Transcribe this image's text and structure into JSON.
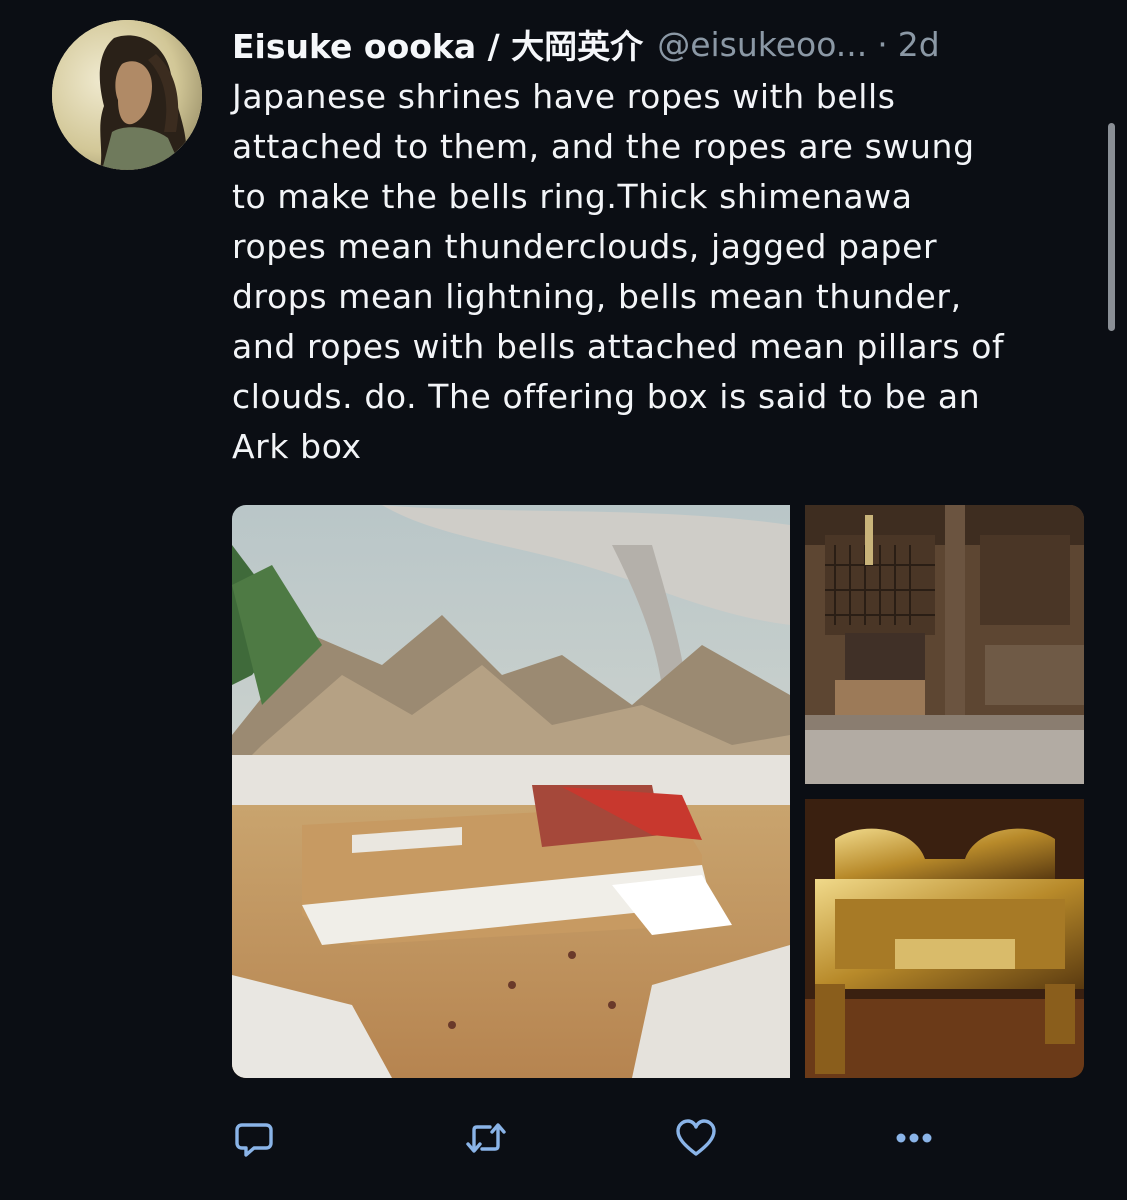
{
  "tweet": {
    "display_name": "Eisuke oooka / 大岡英介",
    "handle": "@eisukeoo...",
    "separator": "·",
    "time": "2d",
    "text": "Japanese shrines have ropes with bells\nattached to them, and the ropes are swung\nto make the bells ring.Thick shimenawa\nropes mean thunderclouds, jagged paper\ndrops mean lightning, bells mean thunder,\nand ropes with bells attached mean pillars of\nclouds. do. The offering box is said to be an\nArk box"
  },
  "avatar": {
    "icon": "profile-photo"
  },
  "media": [
    {
      "name": "tabernacle-camp-illustration"
    },
    {
      "name": "shrine-offering-box-photo"
    },
    {
      "name": "golden-ark-photo"
    }
  ],
  "actions": [
    {
      "name": "reply",
      "icon": "reply-icon"
    },
    {
      "name": "retweet",
      "icon": "retweet-icon"
    },
    {
      "name": "like",
      "icon": "heart-icon"
    },
    {
      "name": "more",
      "icon": "more-icon"
    }
  ],
  "colors": {
    "background": "#0b0e14",
    "text": "#f2f4f7",
    "secondary": "#8b98a5",
    "action": "#8ab4e8"
  }
}
